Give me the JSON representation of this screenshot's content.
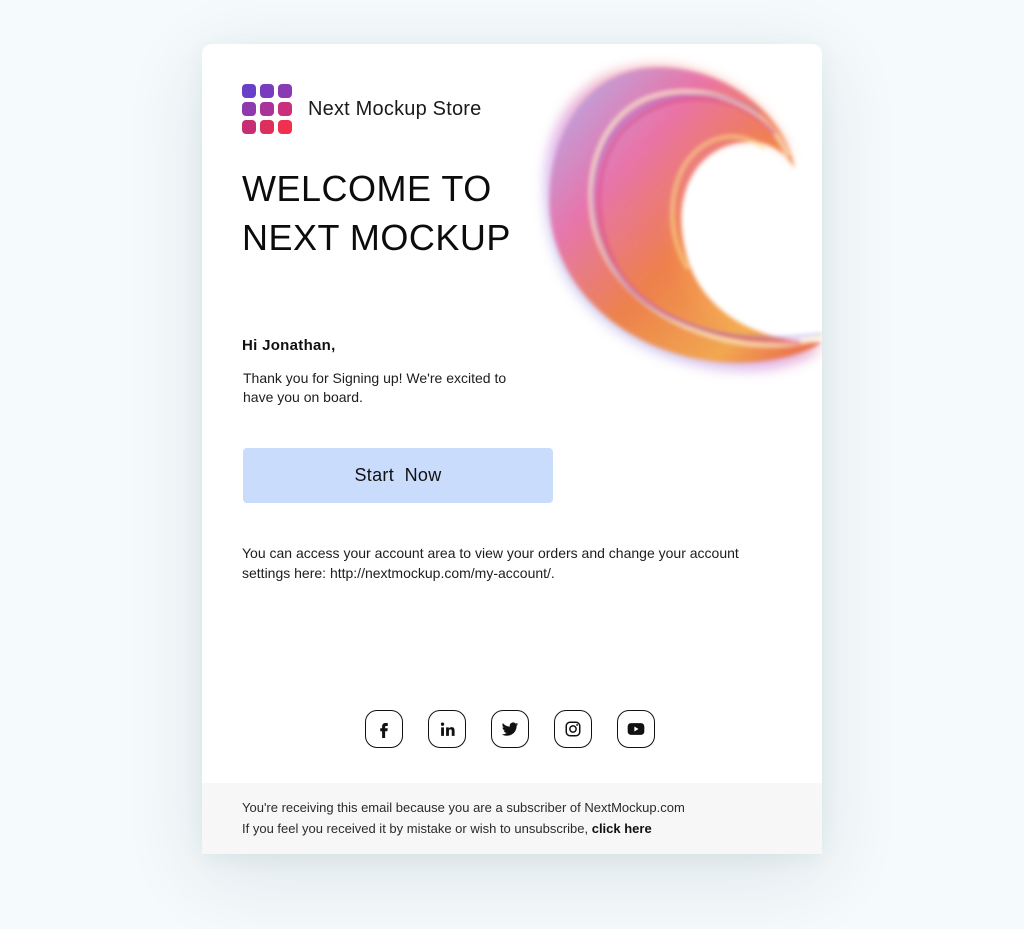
{
  "brand": {
    "name": "Next Mockup Store"
  },
  "headline": {
    "line1": "WELCOME TO",
    "line2": "NEXT MOCKUP"
  },
  "greeting": "Hi Jonathan,",
  "intro": "Thank you for Signing up! We're excited to have you on board.",
  "cta": {
    "label": "Start  Now"
  },
  "account_text": "You can access your account area to view your orders and change your account settings here: http://nextmockup.com/my-account/.",
  "social": [
    {
      "name": "facebook-icon"
    },
    {
      "name": "linkedin-icon"
    },
    {
      "name": "twitter-icon"
    },
    {
      "name": "instagram-icon"
    },
    {
      "name": "youtube-icon"
    }
  ],
  "footer": {
    "line1": "You're receiving this email because you are a subscriber of NextMockup.com",
    "line2_prefix": "If you feel you received it by mistake or wish to unsubscribe, ",
    "unsubscribe_link": "click here"
  },
  "colors": {
    "page_bg": "#f5fafc",
    "card_bg": "#ffffff",
    "cta_bg": "#cadcfc",
    "footer_bg": "#f7f7f7",
    "logo_gradient": [
      "#6a3fc7",
      "#f0304e"
    ]
  }
}
